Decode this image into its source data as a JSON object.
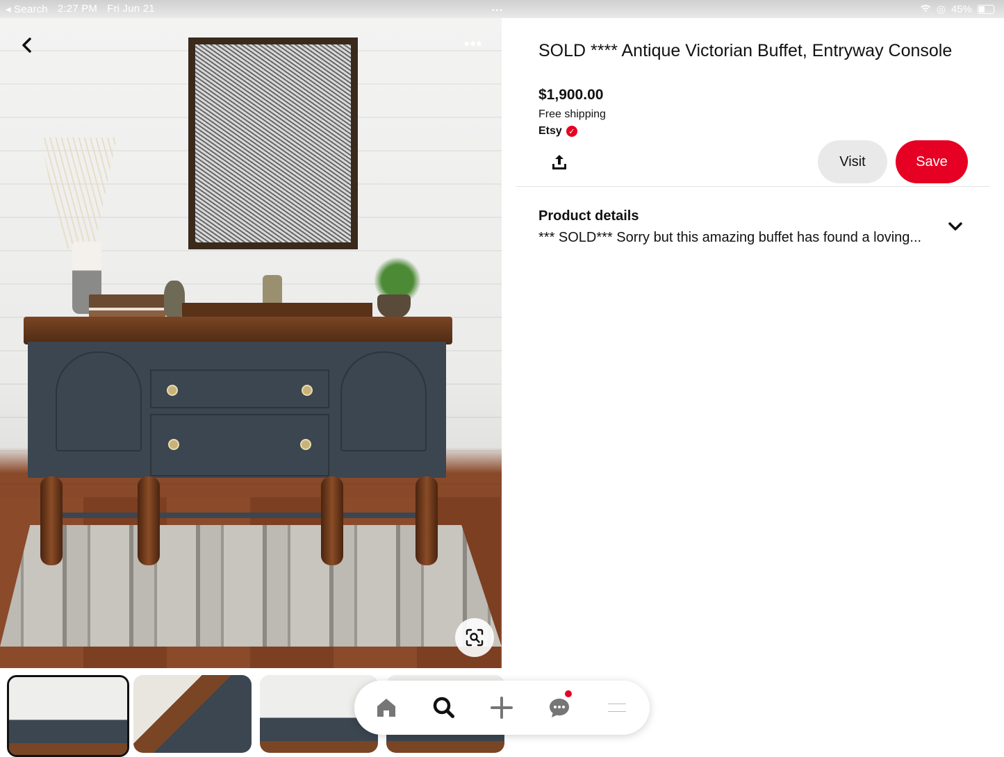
{
  "status_bar": {
    "back_app": "◂ Search",
    "time": "2:27 PM",
    "date": "Fri Jun 21",
    "battery": "45%"
  },
  "product": {
    "title": "SOLD **** Antique Victorian Buffet, Entryway Console",
    "price": "$1,900.00",
    "shipping": "Free shipping",
    "seller": "Etsy",
    "seller_verified": true
  },
  "actions": {
    "visit_label": "Visit",
    "save_label": "Save"
  },
  "details": {
    "heading": "Product details",
    "description": "*** SOLD*** Sorry but this amazing buffet has found a loving..."
  },
  "thumbnails": [
    {
      "selected": true
    },
    {
      "selected": false
    },
    {
      "selected": false
    },
    {
      "selected": false
    }
  ],
  "bottom_nav": {
    "items": [
      "home-icon",
      "search-icon",
      "plus-icon",
      "chat-icon",
      "profile-icon"
    ],
    "chat_has_notification": true
  },
  "colors": {
    "accent": "#e60023",
    "visit_bg": "#e9e9e9",
    "text": "#111111"
  }
}
